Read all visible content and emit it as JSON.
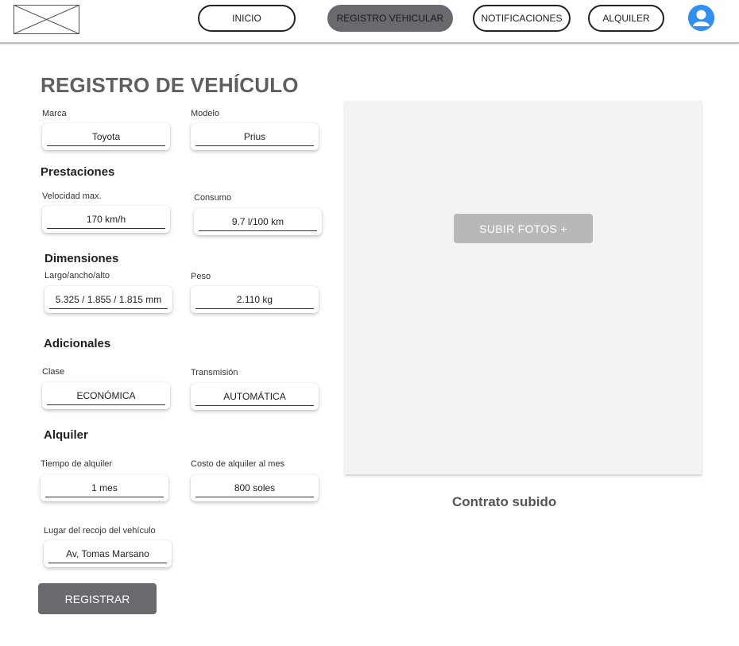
{
  "header": {
    "nav": {
      "inicio": "INICIO",
      "registro": "REGISTRO VEHICULAR",
      "notificaciones": "NOTIFICACIONES",
      "alquiler": "ALQUILER"
    },
    "logo_icon": "image-placeholder-icon",
    "avatar_icon": "user-avatar-icon",
    "accent_color": "#2f8ff2"
  },
  "title": "REGISTRO DE VEHÍCULO",
  "form": {
    "marca": {
      "label": "Marca",
      "value": "Toyota"
    },
    "modelo": {
      "label": "Modelo",
      "value": "Prius"
    },
    "prestaciones_title": "Prestaciones",
    "velocidad": {
      "label": "Velocidad max.",
      "value": "170 km/h"
    },
    "consumo": {
      "label": "Consumo",
      "value": "9.7 l/100 km"
    },
    "dimensiones_title": "Dimensiones",
    "largo": {
      "label": "Largo/ancho/alto",
      "value": "5.325 / 1.855 / 1.815 mm"
    },
    "peso": {
      "label": "Peso",
      "value": "2.110 kg"
    },
    "adicionales_title": "Adicionales",
    "clase": {
      "label": "Clase",
      "value": "ECONÓMICA"
    },
    "transmision": {
      "label": "Transmisión",
      "value": "AUTOMÁTICA"
    },
    "alquiler_title": "Alquiler",
    "tiempo": {
      "label": "Tiempo de alquiler",
      "value": "1 mes"
    },
    "costo": {
      "label": "Costo de alquiler al mes",
      "value": "800 soles"
    },
    "lugar": {
      "label": "Lugar del recojo del vehículo",
      "value": "Av, Tomas Marsano"
    }
  },
  "upload_label": "SUBIR FOTOS +",
  "contract_status": "Contrato subido",
  "register_label": "REGISTRAR",
  "primary_button_color": "#6a696d"
}
